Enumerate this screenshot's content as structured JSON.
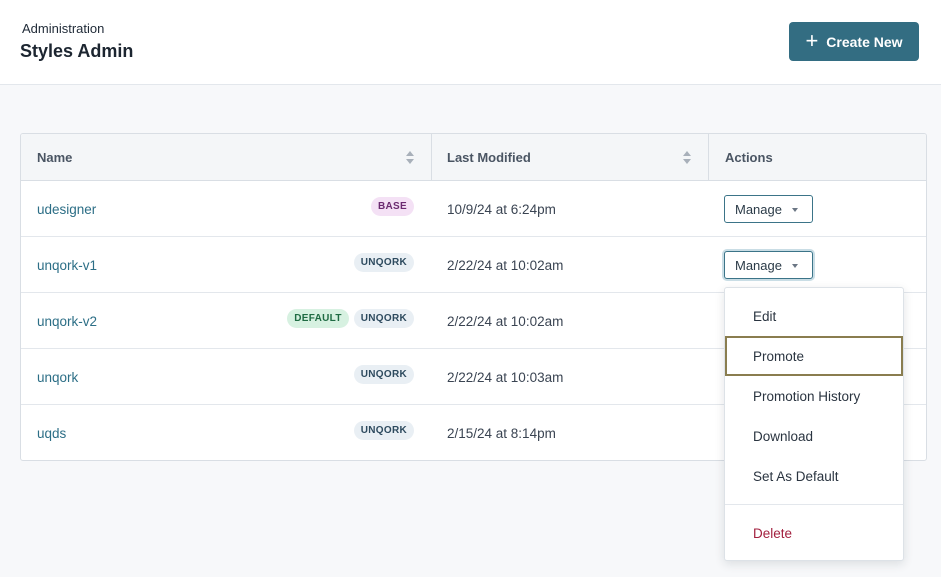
{
  "header": {
    "eyebrow": "Administration",
    "title": "Styles Admin",
    "create_label": "Create New",
    "accent": "#336d82"
  },
  "table": {
    "columns": {
      "name": "Name",
      "last_modified": "Last Modified",
      "actions": "Actions"
    },
    "manage_label": "Manage",
    "rows": [
      {
        "name": "udesigner",
        "badges": [
          "BASE"
        ],
        "modified": "10/9/24 at 6:24pm"
      },
      {
        "name": "unqork-v1",
        "badges": [
          "UNQORK"
        ],
        "modified": "2/22/24 at 10:02am"
      },
      {
        "name": "unqork-v2",
        "badges": [
          "DEFAULT",
          "UNQORK"
        ],
        "modified": "2/22/24 at 10:02am"
      },
      {
        "name": "unqork",
        "badges": [
          "UNQORK"
        ],
        "modified": "2/22/24 at 10:03am"
      },
      {
        "name": "uqds",
        "badges": [
          "UNQORK"
        ],
        "modified": "2/15/24 at 8:14pm"
      }
    ]
  },
  "dropdown": {
    "items": [
      "Edit",
      "Promote",
      "Promotion History",
      "Download",
      "Set As Default"
    ],
    "danger_item": "Delete",
    "highlighted": "Promote"
  }
}
